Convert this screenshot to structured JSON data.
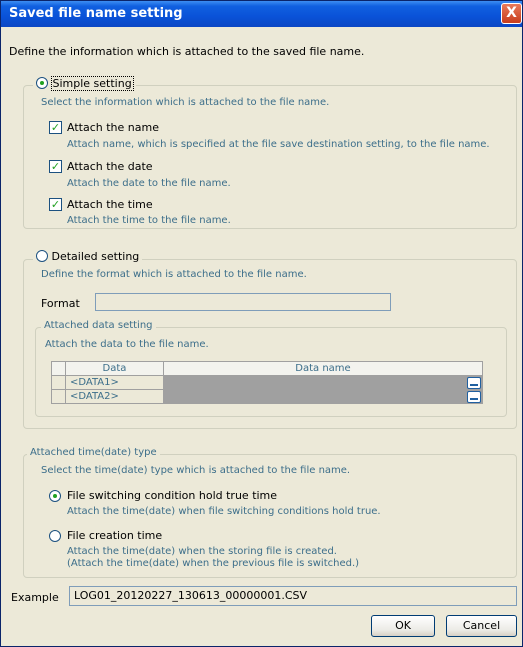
{
  "window": {
    "title": "Saved file name setting",
    "close_glyph": "X"
  },
  "intro": "Define the information which is attached to the saved file name.",
  "simple": {
    "label": "Simple setting",
    "hint": "Select the information which is attached to the file name.",
    "options": [
      {
        "label": "Attach the name",
        "hint": "Attach name, which is specified at the file save destination setting, to the file name.",
        "checked": true,
        "mark": "✓"
      },
      {
        "label": "Attach the date",
        "hint": "Attach the date to the file name.",
        "checked": true,
        "mark": "✓"
      },
      {
        "label": "Attach the time",
        "hint": "Attach the time to the file name.",
        "checked": true,
        "mark": "✓"
      }
    ]
  },
  "detailed": {
    "label": "Detailed setting",
    "hint": "Define the format which is attached to the file name.",
    "format_label": "Format",
    "format_value": "",
    "attached": {
      "legend": "Attached data setting",
      "hint": "Attach the data to the file name.",
      "columns": [
        "Data",
        "Data name"
      ],
      "rows": [
        "<DATA1>",
        "<DATA2>"
      ]
    }
  },
  "time_type": {
    "legend": "Attached time(date) type",
    "hint": "Select the time(date) type which is attached to the file name.",
    "options": [
      {
        "label": "File switching condition hold true time",
        "hint": "Attach the time(date) when file switching conditions hold true.",
        "selected": true
      },
      {
        "label": "File creation time",
        "hint1": "Attach the time(date) when the storing file is created.",
        "hint2": "(Attach the time(date) when the previous file is switched.)",
        "selected": false
      }
    ]
  },
  "example": {
    "label": "Example",
    "value": "LOG01_20120227_130613_00000001.CSV"
  },
  "buttons": {
    "ok": "OK",
    "cancel": "Cancel"
  },
  "colors": {
    "titlebar": "#0a52d8",
    "hint_text": "#3c6e8a",
    "dialog_bg": "#ece9d8"
  }
}
